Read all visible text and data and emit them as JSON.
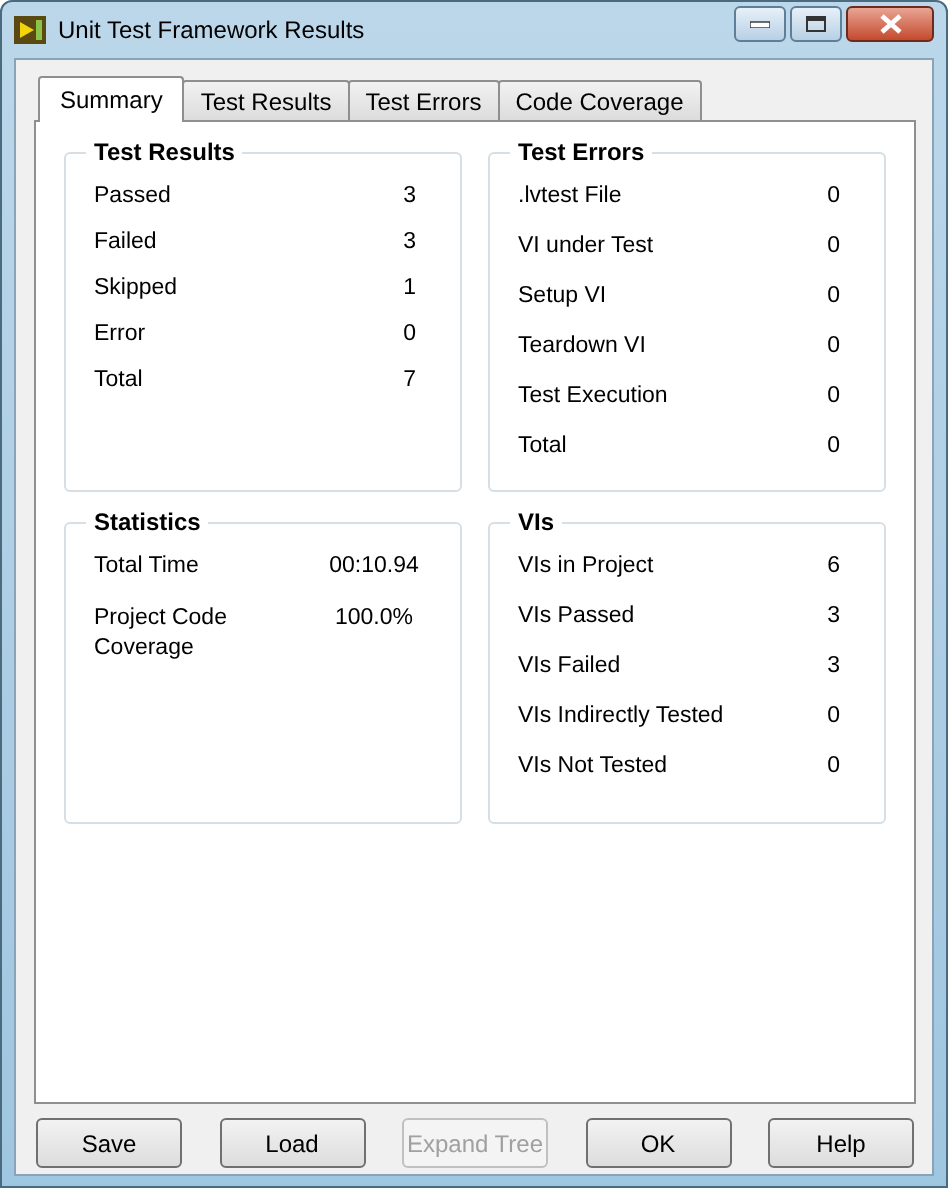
{
  "window": {
    "title": "Unit Test Framework Results"
  },
  "tabs": [
    {
      "label": "Summary",
      "selected": true
    },
    {
      "label": "Test Results",
      "selected": false
    },
    {
      "label": "Test Errors",
      "selected": false
    },
    {
      "label": "Code Coverage",
      "selected": false
    }
  ],
  "groups": [
    {
      "title": "Test Results",
      "rows": [
        {
          "label": "Passed",
          "value": "3"
        },
        {
          "label": "Failed",
          "value": "3"
        },
        {
          "label": "Skipped",
          "value": "1"
        },
        {
          "label": "Error",
          "value": "0"
        },
        {
          "label": "Total",
          "value": "7"
        }
      ]
    },
    {
      "title": "Test Errors",
      "rows": [
        {
          "label": ".lvtest File",
          "value": "0"
        },
        {
          "label": "VI under Test",
          "value": "0"
        },
        {
          "label": "Setup VI",
          "value": "0"
        },
        {
          "label": "Teardown VI",
          "value": "0"
        },
        {
          "label": "Test Execution",
          "value": "0"
        },
        {
          "label": "Total",
          "value": "0"
        }
      ]
    },
    {
      "title": "Statistics",
      "rows": [
        {
          "label": "Total Time",
          "value": "00:10.94"
        },
        {
          "label": "Project Code Coverage",
          "value": "100.0%"
        }
      ]
    },
    {
      "title": "VIs",
      "rows": [
        {
          "label": "VIs in Project",
          "value": "6"
        },
        {
          "label": "VIs Passed",
          "value": "3"
        },
        {
          "label": "VIs Failed",
          "value": "3"
        },
        {
          "label": "VIs Indirectly Tested",
          "value": "0"
        },
        {
          "label": "VIs Not Tested",
          "value": "0"
        }
      ]
    }
  ],
  "buttons": [
    {
      "label": "Save",
      "disabled": false
    },
    {
      "label": "Load",
      "disabled": false
    },
    {
      "label": "Expand Tree",
      "disabled": true
    },
    {
      "label": "OK",
      "disabled": false
    },
    {
      "label": "Help",
      "disabled": false
    }
  ]
}
